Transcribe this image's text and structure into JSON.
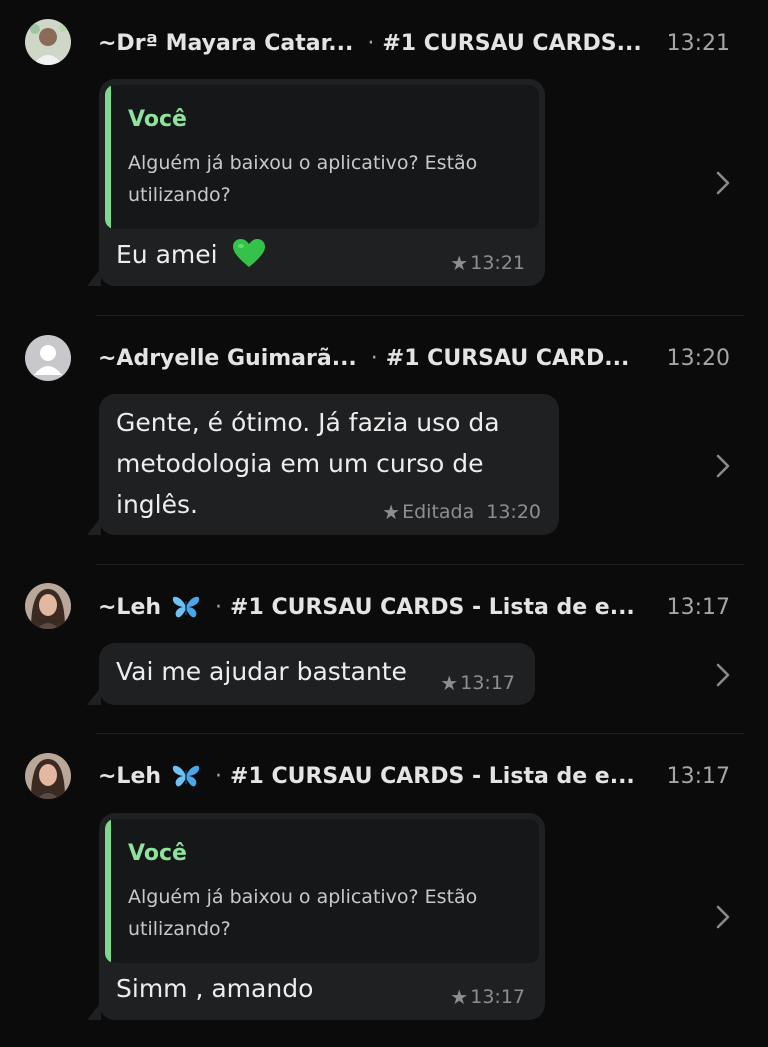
{
  "messages": [
    {
      "sender": "~Drª Mayara Catar...",
      "group": "#1 CURSAU CARDS...",
      "time": "13:21",
      "quote_author": "Você",
      "quote_text": "Alguém já baixou o aplicativo? Estão utilizando?",
      "text": "Eu amei",
      "emoji": "green-heart-icon",
      "star": "★",
      "status": "13:21"
    },
    {
      "sender": "~Adryelle Guimarã...",
      "group": "#1 CURSAU CARD...",
      "time": "13:20",
      "text_lines": [
        "Gente, é ótimo. Já fazia uso da",
        "metodologia em um curso de",
        "inglês."
      ],
      "star": "★",
      "edited": "Editada",
      "status": "13:20"
    },
    {
      "sender": "~Leh",
      "sender_emoji": "butterfly-icon",
      "group": "#1 CURSAU CARDS - Lista de e...",
      "time": "13:17",
      "text": "Vai me ajudar bastante",
      "star": "★",
      "status": "13:17"
    },
    {
      "sender": "~Leh",
      "sender_emoji": "butterfly-icon",
      "group": "#1 CURSAU CARDS - Lista de e...",
      "time": "13:17",
      "quote_author": "Você",
      "quote_text": "Alguém já baixou o aplicativo? Estão utilizando?",
      "text": "Simm , amando",
      "star": "★",
      "status": "13:17"
    }
  ],
  "separator": "·",
  "colors": {
    "background": "#0b0b0b",
    "bubble": "#1f2022",
    "quote_bar": "#7ed98f",
    "quote_author": "#8fe29c"
  }
}
